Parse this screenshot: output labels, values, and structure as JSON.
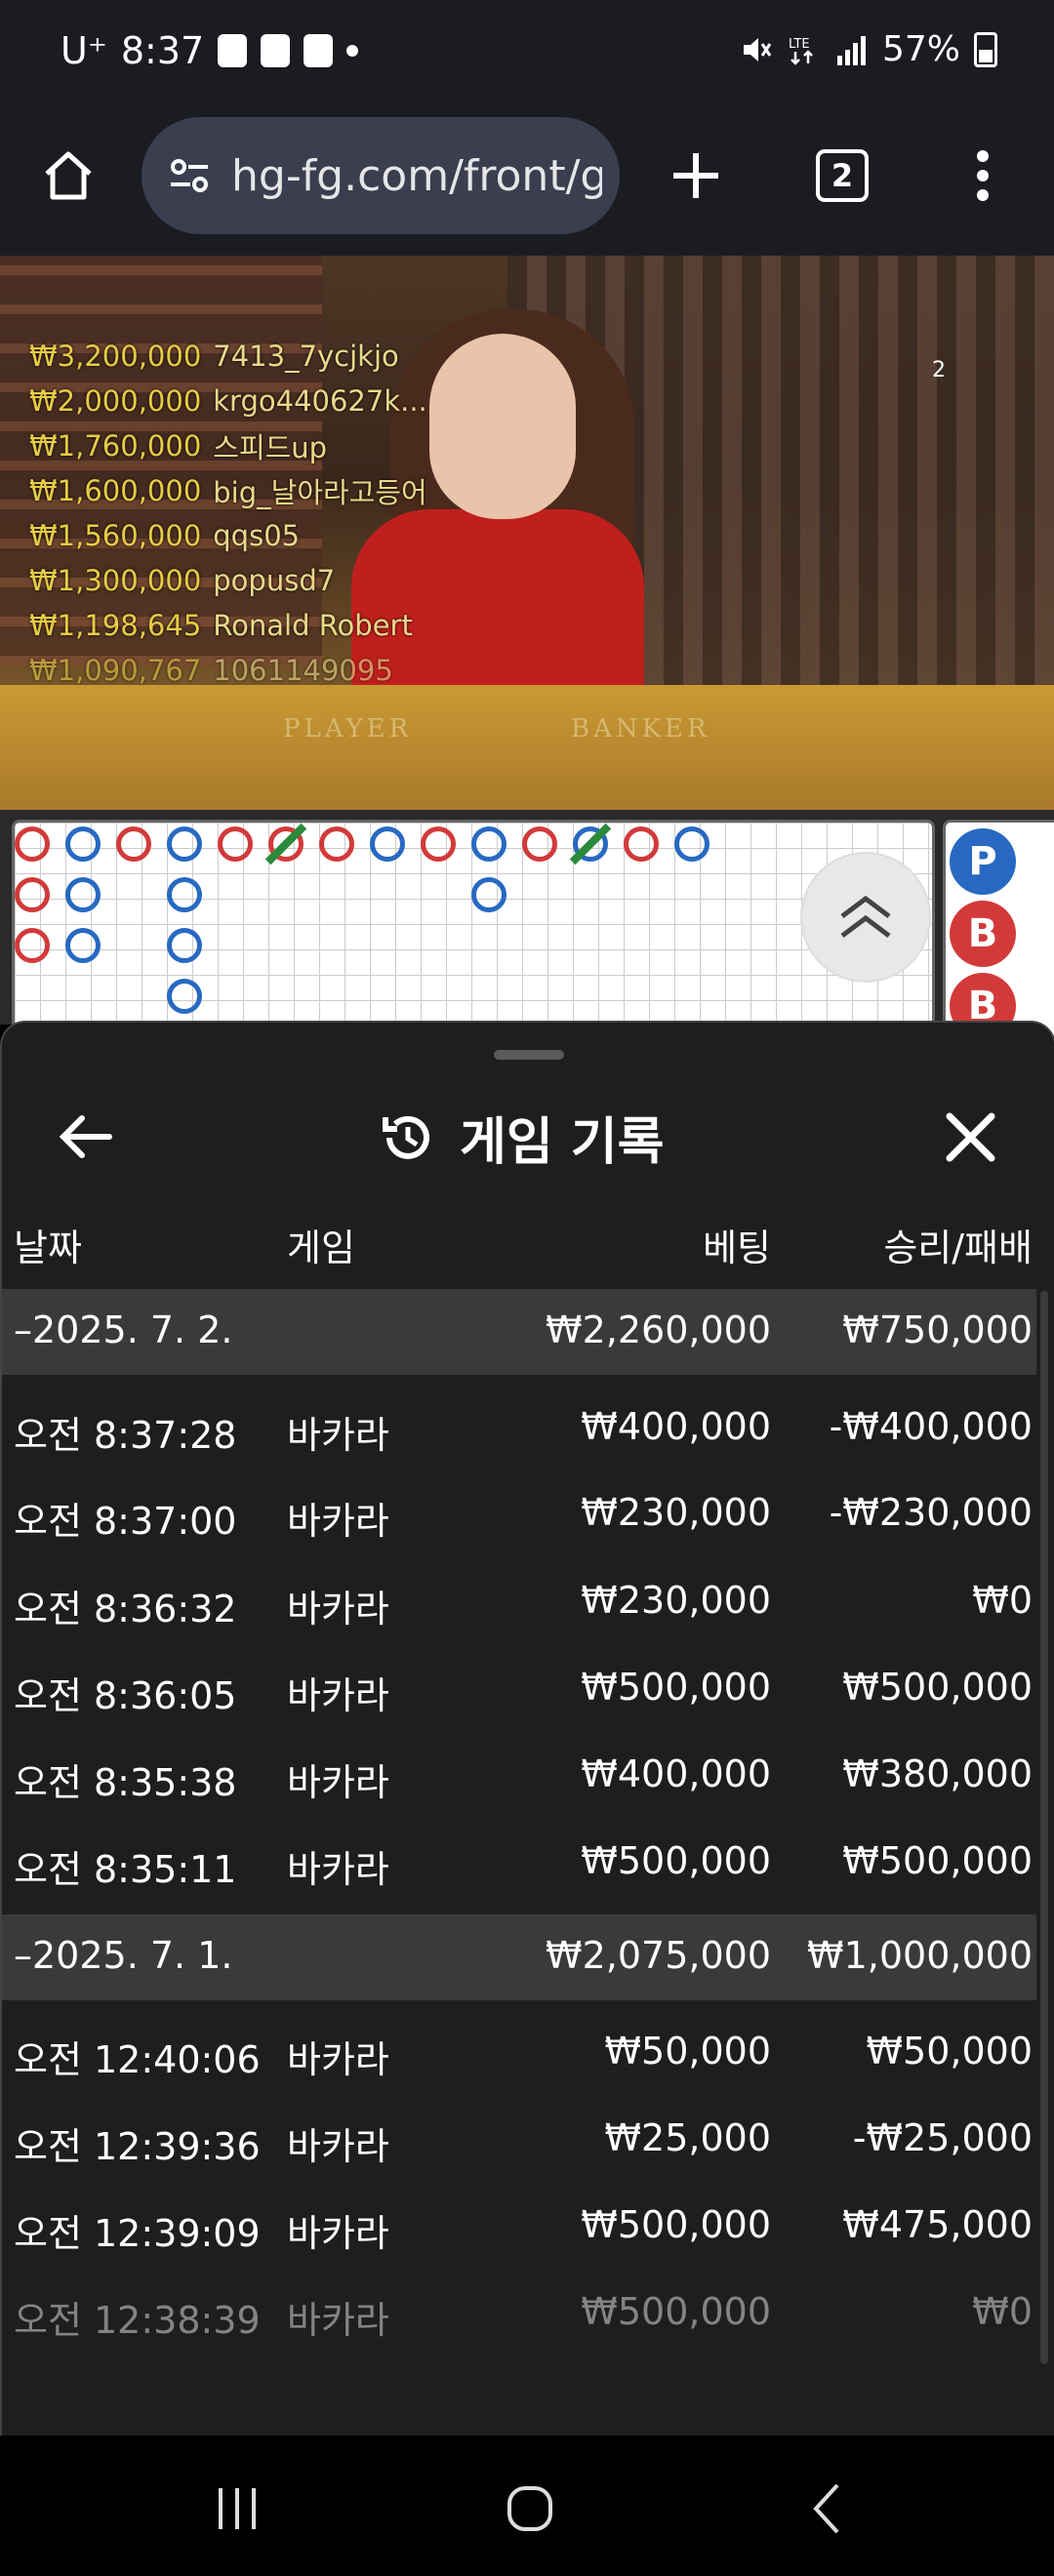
{
  "status_bar": {
    "carrier": "U⁺",
    "time": "8:37",
    "battery": "57%"
  },
  "browser": {
    "url": "hg-fg.com/front/g",
    "tab_count": "2"
  },
  "video": {
    "leaderboard": [
      {
        "amount": "₩3,200,000",
        "name": "7413_7ycjkjo"
      },
      {
        "amount": "₩2,000,000",
        "name": "krgo440627k..."
      },
      {
        "amount": "₩1,760,000",
        "name": "스피드up"
      },
      {
        "amount": "₩1,600,000",
        "name": "big_날아라고등어"
      },
      {
        "amount": "₩1,560,000",
        "name": "qqs05"
      },
      {
        "amount": "₩1,300,000",
        "name": "popusd7"
      },
      {
        "amount": "₩1,198,645",
        "name": "Ronald Robert"
      },
      {
        "amount": "₩1,090,767",
        "name": "1061149095"
      }
    ],
    "table_labels": {
      "player": "PLAYER",
      "banker": "BANKER"
    },
    "corner_number": "2"
  },
  "road": {
    "pb_badges": [
      "P",
      "B",
      "B"
    ]
  },
  "history": {
    "title": "게임 기록",
    "columns": {
      "date": "날짜",
      "game": "게임",
      "bet": "베팅",
      "winloss": "승리/패배"
    },
    "groups": [
      {
        "date": "–2025. 7. 2.",
        "total_bet": "₩2,260,000",
        "total_winloss": "₩750,000",
        "rows": [
          {
            "time": "오전 8:37:28",
            "game": "바카라",
            "bet": "₩400,000",
            "winloss": "-₩400,000"
          },
          {
            "time": "오전 8:37:00",
            "game": "바카라",
            "bet": "₩230,000",
            "winloss": "-₩230,000"
          },
          {
            "time": "오전 8:36:32",
            "game": "바카라",
            "bet": "₩230,000",
            "winloss": "₩0"
          },
          {
            "time": "오전 8:36:05",
            "game": "바카라",
            "bet": "₩500,000",
            "winloss": "₩500,000"
          },
          {
            "time": "오전 8:35:38",
            "game": "바카라",
            "bet": "₩400,000",
            "winloss": "₩380,000"
          },
          {
            "time": "오전 8:35:11",
            "game": "바카라",
            "bet": "₩500,000",
            "winloss": "₩500,000"
          }
        ]
      },
      {
        "date": "–2025. 7. 1.",
        "total_bet": "₩2,075,000",
        "total_winloss": "₩1,000,000",
        "rows": [
          {
            "time": "오전 12:40:06",
            "game": "바카라",
            "bet": "₩50,000",
            "winloss": "₩50,000"
          },
          {
            "time": "오전 12:39:36",
            "game": "바카라",
            "bet": "₩25,000",
            "winloss": "-₩25,000"
          },
          {
            "time": "오전 12:39:09",
            "game": "바카라",
            "bet": "₩500,000",
            "winloss": "₩475,000"
          },
          {
            "time": "오전 12:38:39",
            "game": "바카라",
            "bet": "₩500,000",
            "winloss": "₩0"
          }
        ]
      }
    ]
  },
  "colors": {
    "banker_red": "#d23a3a",
    "player_blue": "#2769c2",
    "tie_green": "#2a8a3b",
    "sheet_bg": "#1e1e20",
    "date_row_bg": "#3a3a3d"
  }
}
